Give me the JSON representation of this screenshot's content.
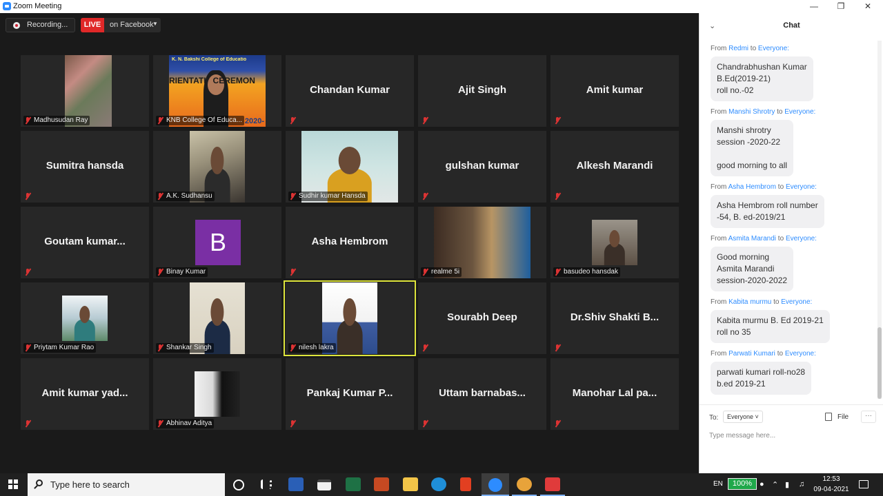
{
  "window": {
    "title": "Zoom Meeting"
  },
  "status": {
    "recording": "Recording...",
    "live_badge": "LIVE",
    "live_target": "on Facebook"
  },
  "grid": {
    "rows": [
      [
        {
          "name": "Madhusudan Ray",
          "video": true
        },
        {
          "name": "KNB College Of Educa...",
          "video": true
        },
        {
          "name": "Chandan Kumar",
          "video": false
        },
        {
          "name": "Ajit Singh",
          "video": false
        },
        {
          "name": "Amit kumar",
          "video": false
        }
      ],
      [
        {
          "name": "Sumitra hansda",
          "video": false
        },
        {
          "name": "A.K. Sudhansu",
          "video": true
        },
        {
          "name": "Sudhir kumar Hansda",
          "video": true
        },
        {
          "name": "gulshan kumar",
          "video": false
        },
        {
          "name": "Alkesh Marandi",
          "video": false
        }
      ],
      [
        {
          "name": "Goutam kumar...",
          "video": false
        },
        {
          "name": "Binay Kumar",
          "video": false,
          "avatar": "B"
        },
        {
          "name": "Asha Hembrom",
          "video": false
        },
        {
          "name": "realme 5i",
          "video": true
        },
        {
          "name": "basudeo hansdak",
          "video": true
        }
      ],
      [
        {
          "name": "Priytam Kumar Rao",
          "video": true
        },
        {
          "name": "Shankar Singh",
          "video": true
        },
        {
          "name": "nilesh lakra",
          "video": true,
          "active": true
        },
        {
          "name": "Sourabh Deep",
          "video": false
        },
        {
          "name": "Dr.Shiv Shakti B...",
          "video": false
        }
      ],
      [
        {
          "name": "Amit kumar yad...",
          "video": false
        },
        {
          "name": "Abhinav Aditya",
          "video": true
        },
        {
          "name": "Pankaj Kumar P...",
          "video": false
        },
        {
          "name": "Uttam barnabas...",
          "video": false
        },
        {
          "name": "Manohar Lal pa...",
          "video": false
        }
      ]
    ],
    "banner_text": {
      "college": "K. N. Bakshi College of Educatio",
      "ceremony": "RIENTATI   CEREMON",
      "year": "2020-"
    }
  },
  "chat": {
    "title": "Chat",
    "from_word": "From",
    "to_word": "to",
    "messages": [
      {
        "from": "Redmi",
        "to": "Everyone:",
        "text": "Chandrabhushan Kumar\nB.Ed(2019-21)\nroll no.-02"
      },
      {
        "from": "Manshi Shrotry",
        "to": "Everyone:",
        "text": "Manshi shrotry\nsession -2020-22\n\ngood morning to all"
      },
      {
        "from": "Asha Hembrom",
        "to": "Everyone:",
        "text": "Asha Hembrom roll number\n-54, B. ed-2019/21"
      },
      {
        "from": "Asmita Marandi",
        "to": "Everyone:",
        "text": "Good morning\nAsmita Marandi\nsession-2020-2022"
      },
      {
        "from": "Kabita murmu",
        "to": "Everyone:",
        "text": "Kabita murmu B. Ed 2019-21\nroll no 35"
      },
      {
        "from": "Parwati Kumari",
        "to": "Everyone:",
        "text": "parwati kumari roll-no28\nb.ed 2019-21"
      }
    ],
    "composer": {
      "to_label": "To:",
      "recipient": "Everyone",
      "file_label": "File",
      "more_label": "···",
      "placeholder": "Type message here..."
    }
  },
  "taskbar": {
    "search_placeholder": "Type here to search",
    "language": "EN",
    "battery": "100%",
    "time": "12:53",
    "date": "09-04-2021"
  }
}
